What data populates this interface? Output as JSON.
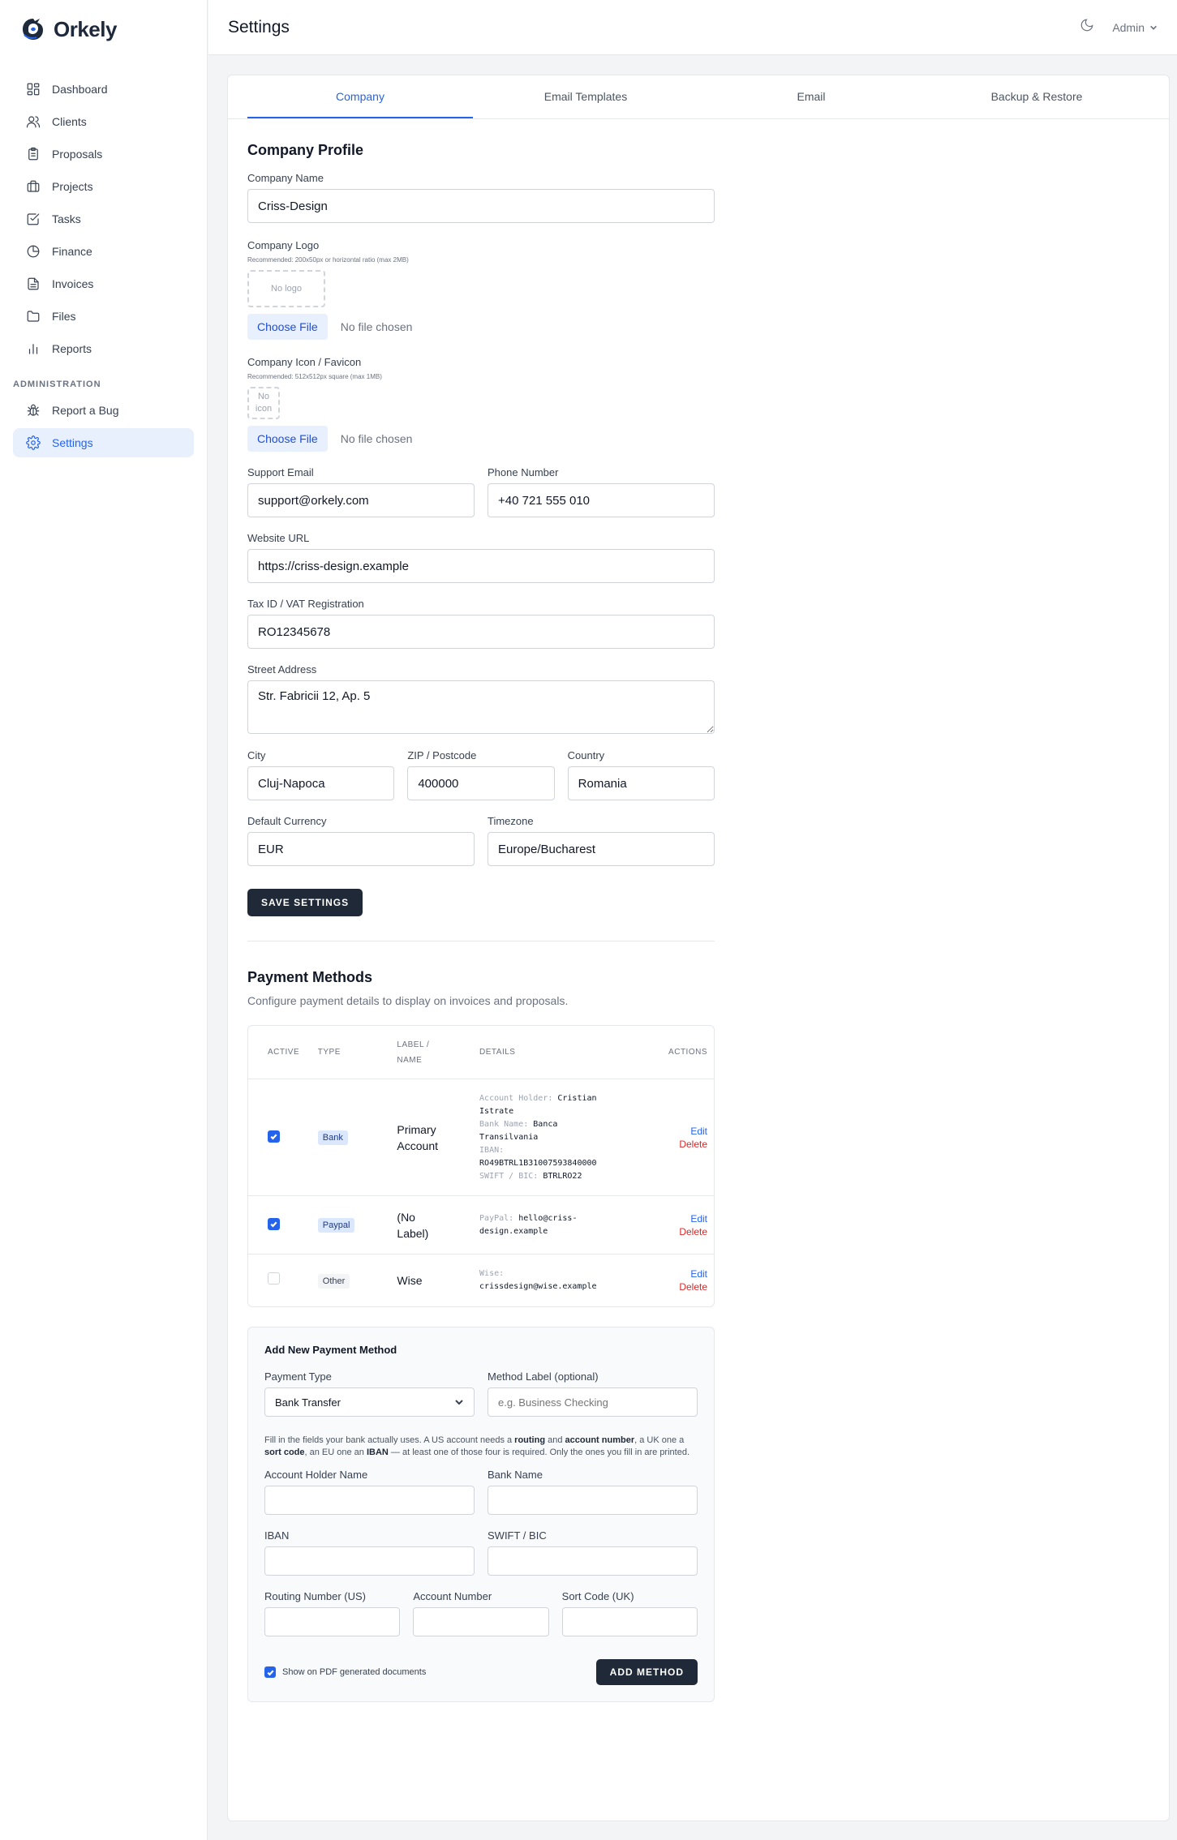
{
  "app": {
    "name": "Orkely"
  },
  "sidebar": {
    "items": [
      {
        "label": "Dashboard",
        "icon": "dashboard-icon"
      },
      {
        "label": "Clients",
        "icon": "users-icon"
      },
      {
        "label": "Proposals",
        "icon": "clipboard-icon"
      },
      {
        "label": "Projects",
        "icon": "briefcase-icon"
      },
      {
        "label": "Tasks",
        "icon": "check-square-icon"
      },
      {
        "label": "Finance",
        "icon": "pie-chart-icon"
      },
      {
        "label": "Invoices",
        "icon": "file-icon"
      },
      {
        "label": "Files",
        "icon": "folder-icon"
      },
      {
        "label": "Reports",
        "icon": "bar-chart-icon"
      }
    ],
    "admin_section": "ADMINISTRATION",
    "admin_items": [
      {
        "label": "Report a Bug",
        "icon": "bug-icon"
      },
      {
        "label": "Settings",
        "icon": "gear-icon",
        "active": true
      }
    ]
  },
  "header": {
    "title": "Settings",
    "user": "Admin"
  },
  "tabs": [
    "Company",
    "Email Templates",
    "Email",
    "Backup & Restore"
  ],
  "company": {
    "section_title": "Company Profile",
    "name_label": "Company Name",
    "name_value": "Criss-Design",
    "logo_label": "Company Logo",
    "logo_hint": "Recommended: 200x50px or horizontal ratio (max 2MB)",
    "logo_placeholder": "No logo",
    "choose_file": "Choose File",
    "no_file": "No file chosen",
    "icon_label": "Company Icon / Favicon",
    "icon_hint": "Recommended: 512x512px square (max 1MB)",
    "icon_placeholder_1": "No",
    "icon_placeholder_2": "icon",
    "support_email_label": "Support Email",
    "support_email_value": "support@orkely.com",
    "phone_label": "Phone Number",
    "phone_value": "+40 721 555 010",
    "website_label": "Website URL",
    "website_value": "https://criss-design.example",
    "tax_label": "Tax ID / VAT Registration",
    "tax_value": "RO12345678",
    "street_label": "Street Address",
    "street_value": "Str. Fabricii 12, Ap. 5",
    "city_label": "City",
    "city_value": "Cluj-Napoca",
    "zip_label": "ZIP / Postcode",
    "zip_value": "400000",
    "country_label": "Country",
    "country_value": "Romania",
    "currency_label": "Default Currency",
    "currency_value": "EUR",
    "timezone_label": "Timezone",
    "timezone_value": "Europe/Bucharest",
    "save_label": "SAVE SETTINGS"
  },
  "payment": {
    "title": "Payment Methods",
    "subtitle": "Configure payment details to display on invoices and proposals.",
    "columns": {
      "active": "ACTIVE",
      "type": "TYPE",
      "label_1": "LABEL /",
      "label_2": "NAME",
      "details": "DETAILS",
      "actions": "ACTIONS"
    },
    "edit": "Edit",
    "delete": "Delete",
    "rows": [
      {
        "active": true,
        "type": "Bank",
        "label_1": "Primary",
        "label_2": "Account",
        "d1k": "Account Holder:",
        "d1v": "Cristian",
        "d1c": "Istrate",
        "d2k": "Bank Name:",
        "d2v": "Banca",
        "d2c": "Transilvania",
        "d3k": "IBAN:",
        "d3v": "RO49BTRL1B31007593840000",
        "d4k": "SWIFT / BIC:",
        "d4v": "BTRLRO22"
      },
      {
        "active": true,
        "type": "Paypal",
        "label_1": "(No",
        "label_2": "Label)",
        "dk": "PayPal:",
        "dv": "hello@criss-",
        "dc": "design.example"
      },
      {
        "active": false,
        "type": "Other",
        "label_1": "Wise",
        "dk": "Wise:",
        "dv": "crissdesign@wise.example"
      }
    ]
  },
  "add_method": {
    "title": "Add New Payment Method",
    "type_label": "Payment Type",
    "type_value": "Bank Transfer",
    "method_label": "Method Label (optional)",
    "method_placeholder": "e.g. Business Checking",
    "help_1": "Fill in the fields your bank actually uses. A US account needs a ",
    "help_b1": "routing",
    "help_2": " and ",
    "help_b2": "account number",
    "help_3": ", a UK one a ",
    "help_b3": "sort code",
    "help_4": ", an EU one an ",
    "help_b4": "IBAN",
    "help_5": " — at least one of those four is required. Only the ones you fill in are printed.",
    "holder_label": "Account Holder Name",
    "bank_label": "Bank Name",
    "iban_label": "IBAN",
    "swift_label": "SWIFT / BIC",
    "routing_label": "Routing Number (US)",
    "account_label": "Account Number",
    "sort_label": "Sort Code (UK)",
    "show_pdf": "Show on PDF generated documents",
    "add_button": "ADD METHOD"
  },
  "colors": {
    "accent": "#2563eb",
    "dark": "#1f2937",
    "danger": "#dc2626"
  }
}
